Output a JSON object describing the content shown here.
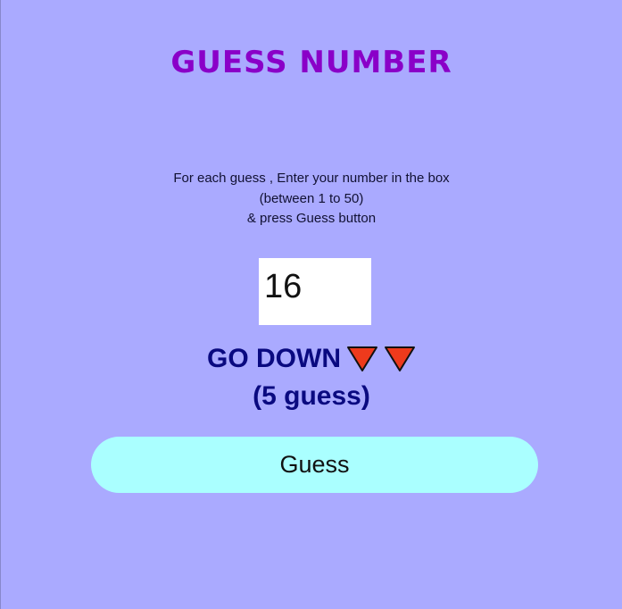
{
  "header": {
    "title": "GUESS NUMBER"
  },
  "instructions": {
    "line1": "For each guess , Enter your number in the box",
    "line2": "(between 1 to 50)",
    "line3": "& press Guess button"
  },
  "guess_input": {
    "value": "16"
  },
  "hint": {
    "direction_text": "GO DOWN",
    "arrow_icon": "down-triangle-icon",
    "arrow_color": "#ee3a1c",
    "guess_count": "(5 guess)"
  },
  "actions": {
    "guess_label": "Guess"
  },
  "colors": {
    "background": "#aaaaff",
    "title": "#8a00c8",
    "hint_text": "#0a0a80",
    "button_bg": "#aaffff"
  }
}
